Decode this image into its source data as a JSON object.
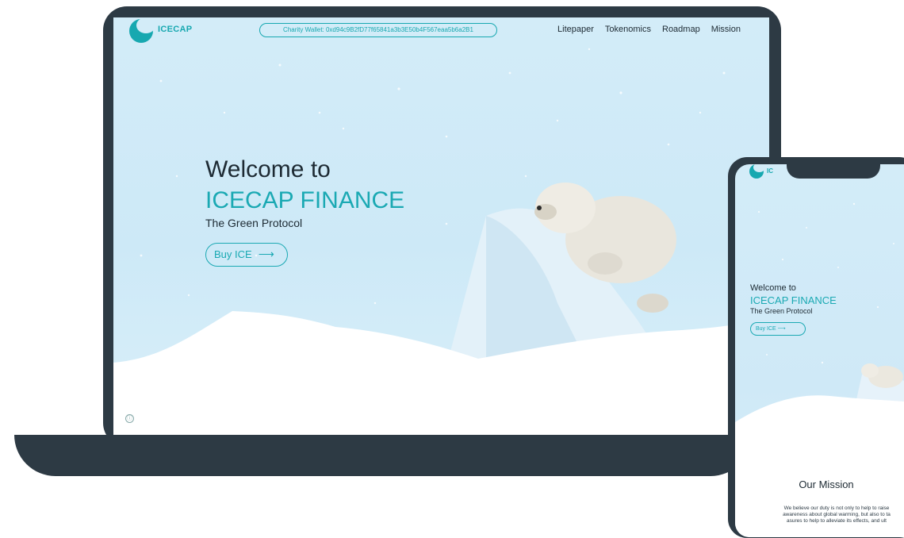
{
  "laptop": {
    "logo_text": "ICECAP",
    "wallet_label": "Charity Wallet: 0xd94c9B2fD77f65841a3b3E50b4F567eaa5b6a2B1",
    "nav": [
      "Litepaper",
      "Tokenomics",
      "Roadmap",
      "Mission"
    ],
    "hero": {
      "welcome": "Welcome to",
      "brand": "ICECAP FINANCE",
      "subtitle": "The Green Protocol",
      "buy_label": "Buy ICE",
      "buy_arrow": "⟶"
    },
    "info_icon": "ⓘ"
  },
  "phone": {
    "logo_text": "IC",
    "hero": {
      "welcome": "Welcome to",
      "brand": "ICECAP FINANCE",
      "subtitle": "The Green Protocol",
      "buy_label": "Buy ICE",
      "buy_arrow": "⟶"
    },
    "mission_title": "Our Mission",
    "mission_text": [
      "We believe our duty is not only to help to raise",
      "awareness about global warming, but also to ta",
      "asures to help to alleviate its effects, and ult"
    ]
  },
  "colors": {
    "accent": "#1aa9b3",
    "device_frame": "#2d3a44",
    "sky": "#d3ecf8",
    "text_dark": "#1d2a33"
  },
  "icons": [
    "polar-bear-logo-icon",
    "arrow-right-icon",
    "info-icon"
  ]
}
